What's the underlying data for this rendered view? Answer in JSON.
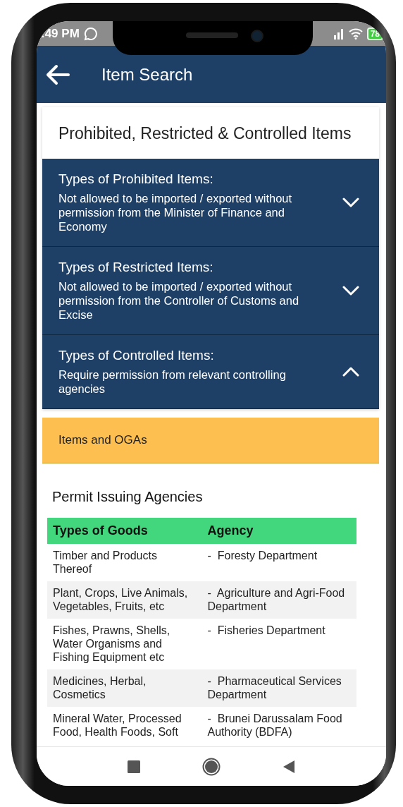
{
  "status_bar": {
    "time": ":49 PM",
    "battery": "78"
  },
  "app_bar": {
    "title": "Item Search"
  },
  "card": {
    "title": "Prohibited, Restricted & Controlled Items",
    "sections": [
      {
        "title": "Types of Prohibited Items:",
        "description": "Not allowed to be imported / exported without permission from the Minister of Finance and Economy",
        "expanded": false
      },
      {
        "title": "Types of Restricted Items:",
        "description": "Not allowed to be imported / exported without permission from the Controller of Customs and Excise",
        "expanded": false
      },
      {
        "title": "Types of Controlled Items:",
        "description": "Require permission from relevant controlling agencies",
        "expanded": true
      }
    ]
  },
  "subsection": {
    "title": "Items and OGAs"
  },
  "agencies": {
    "title": "Permit Issuing Agencies",
    "columns": [
      "Types of Goods",
      "Agency"
    ],
    "rows": [
      {
        "goods": "Timber and Products Thereof",
        "agency": "-  Foresty Department"
      },
      {
        "goods": "Plant, Crops, Live Animals, Vegetables, Fruits, etc",
        "agency": "-  Agriculture and Agri-Food Department"
      },
      {
        "goods": "Fishes, Prawns, Shells, Water Organisms and Fishing Equipment etc",
        "agency": "-  Fisheries Department"
      },
      {
        "goods": "Medicines, Herbal, Cosmetics",
        "agency": "-  Pharmaceutical Services Department"
      },
      {
        "goods": "Mineral Water, Processed Food, Health Foods, Soft",
        "agency": "-  Brunei Darussalam Food Authority (BDFA)"
      }
    ]
  }
}
